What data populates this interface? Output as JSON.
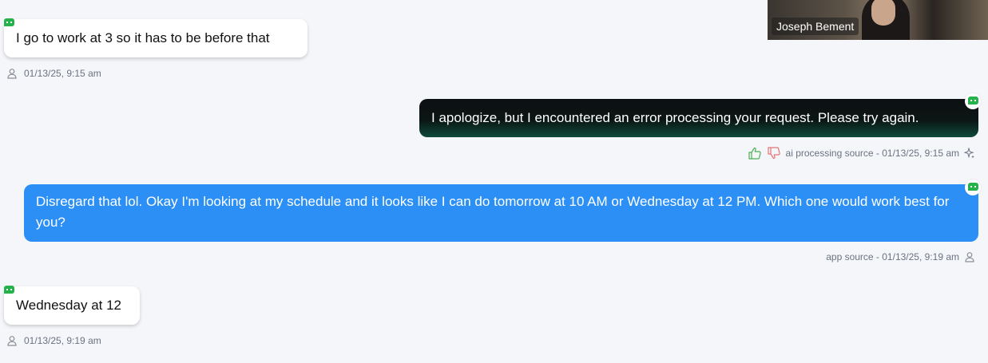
{
  "video": {
    "participant_name": "Joseph Bement"
  },
  "messages": [
    {
      "text": "I go to work at 3 so it has to be before that",
      "meta": "01/13/25, 9:15 am"
    },
    {
      "text": "I apologize, but I encountered an error processing your request. Please try again.",
      "meta": "ai processing source - 01/13/25, 9:15 am"
    },
    {
      "text": "Disregard that lol. Okay I'm looking at my schedule and it looks like I can do tomorrow at 10 AM or Wednesday at 12 PM. Which one would work best for you?",
      "meta": "app source - 01/13/25, 9:19 am"
    },
    {
      "text": "Wednesday at 12",
      "meta": "01/13/25, 9:19 am"
    }
  ],
  "icons": {
    "chat_badge": "chat-bubble-icon",
    "user": "user-icon",
    "thumbs_up": "thumbs-up-icon",
    "thumbs_down": "thumbs-down-icon",
    "sparkle": "sparkle-icon"
  },
  "colors": {
    "background": "#f5f6fa",
    "app_bubble": "#2b8ff5",
    "ai_bubble": "#0d0f12",
    "badge_green": "#26b24b",
    "thumbs_up": "#4caf50",
    "thumbs_down": "#e57373"
  }
}
